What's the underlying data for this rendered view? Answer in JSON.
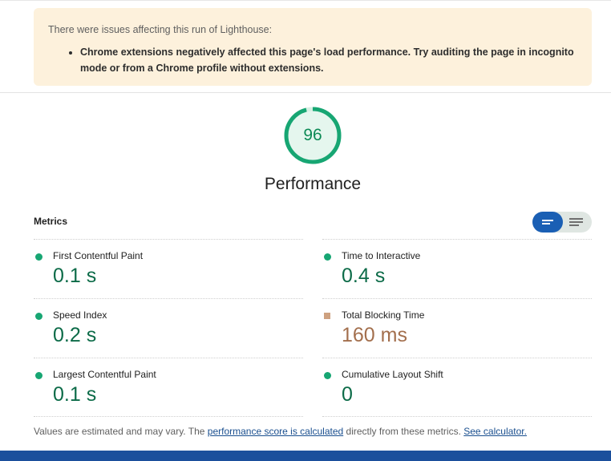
{
  "warning": {
    "title": "There were issues affecting this run of Lighthouse:",
    "items": [
      "Chrome extensions negatively affected this page's load performance. Try auditing the page in incognito mode or from a Chrome profile without extensions."
    ]
  },
  "gauge": {
    "score": "96",
    "fraction": 0.96,
    "color": "#17a673"
  },
  "category": {
    "title": "Performance"
  },
  "metrics_section": {
    "label": "Metrics"
  },
  "toggle": {
    "on_icon": "lines-short-icon",
    "off_icon": "lines-long-icon"
  },
  "metrics": [
    {
      "name": "First Contentful Paint",
      "value": "0.1 s",
      "rating": "pass"
    },
    {
      "name": "Time to Interactive",
      "value": "0.4 s",
      "rating": "pass"
    },
    {
      "name": "Speed Index",
      "value": "0.2 s",
      "rating": "pass"
    },
    {
      "name": "Total Blocking Time",
      "value": "160 ms",
      "rating": "average"
    },
    {
      "name": "Largest Contentful Paint",
      "value": "0.1 s",
      "rating": "pass"
    },
    {
      "name": "Cumulative Layout Shift",
      "value": "0",
      "rating": "pass"
    }
  ],
  "footnote": {
    "prefix": "Values are estimated and may vary. The ",
    "link1": "performance score is calculated",
    "middle": " directly from these metrics. ",
    "link2": "See calculator."
  },
  "colors": {
    "pass": "#17a673",
    "average": "#c6906a",
    "accent": "#1a5fb4"
  }
}
